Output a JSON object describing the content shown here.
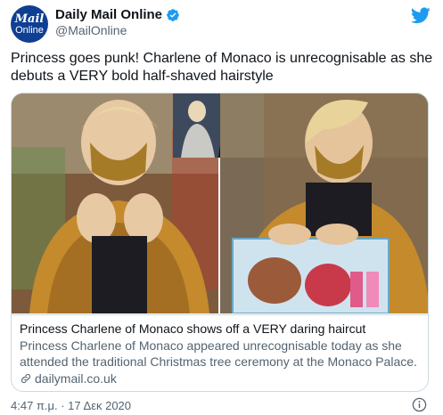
{
  "account": {
    "display_name": "Daily Mail Online",
    "handle": "@MailOnline",
    "avatar_line1": "Mail",
    "avatar_line2": "Online"
  },
  "tweet": {
    "text": "Princess goes punk! Charlene of Monaco is unrecognisable as she debuts a VERY bold half-shaved hairstyle",
    "timestamp": "4:47 π.μ. · 17 Δεκ 2020"
  },
  "card": {
    "title": "Princess Charlene of Monaco shows off a VERY daring haircut",
    "description": "Princess Charlene of Monaco appeared unrecognisable today as she attended the traditional Christmas tree ceremony at the Monaco Palace.",
    "domain": "dailymail.co.uk"
  },
  "colors": {
    "twitter_blue": "#1d9bf0",
    "avatar_blue": "#0f3f93",
    "text_primary": "#0f1419",
    "text_secondary": "#536471",
    "border": "#cfd9de"
  },
  "icons": {
    "verified": "verified-badge-icon",
    "twitter": "twitter-bird-icon",
    "link": "link-icon",
    "info": "info-icon"
  }
}
